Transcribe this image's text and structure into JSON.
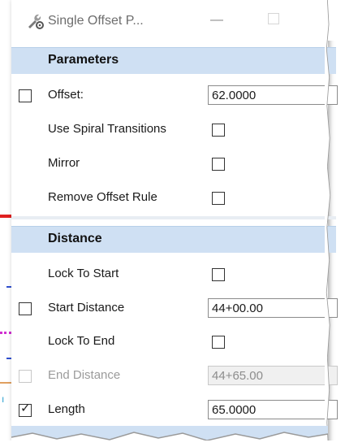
{
  "window": {
    "title": "Single Offset P...",
    "app_icon": "wrench-gear-icon",
    "minimize_glyph": "—"
  },
  "parameters": {
    "header": "Parameters",
    "offset": {
      "label": "Offset:",
      "value": "62.0000",
      "locked": false
    },
    "use_spiral_transitions": {
      "label": "Use Spiral Transitions",
      "checked": false
    },
    "mirror": {
      "label": "Mirror",
      "checked": false
    },
    "remove_offset_rule": {
      "label": "Remove Offset Rule",
      "checked": false
    }
  },
  "distance": {
    "header": "Distance",
    "lock_to_start": {
      "label": "Lock To Start",
      "checked": false
    },
    "start_distance": {
      "label": "Start Distance",
      "value": "44+00.00",
      "locked": false
    },
    "lock_to_end": {
      "label": "Lock To End",
      "checked": false
    },
    "end_distance": {
      "label": "End Distance",
      "value": "44+65.00",
      "locked": false,
      "disabled": true
    },
    "length": {
      "label": "Length",
      "value": "65.0000",
      "locked": true
    }
  },
  "colors": {
    "section_header_bg": "#cfe0f3",
    "canvas_red": "#e02020",
    "canvas_magenta": "#d030d0",
    "canvas_blue": "#3050d0"
  }
}
